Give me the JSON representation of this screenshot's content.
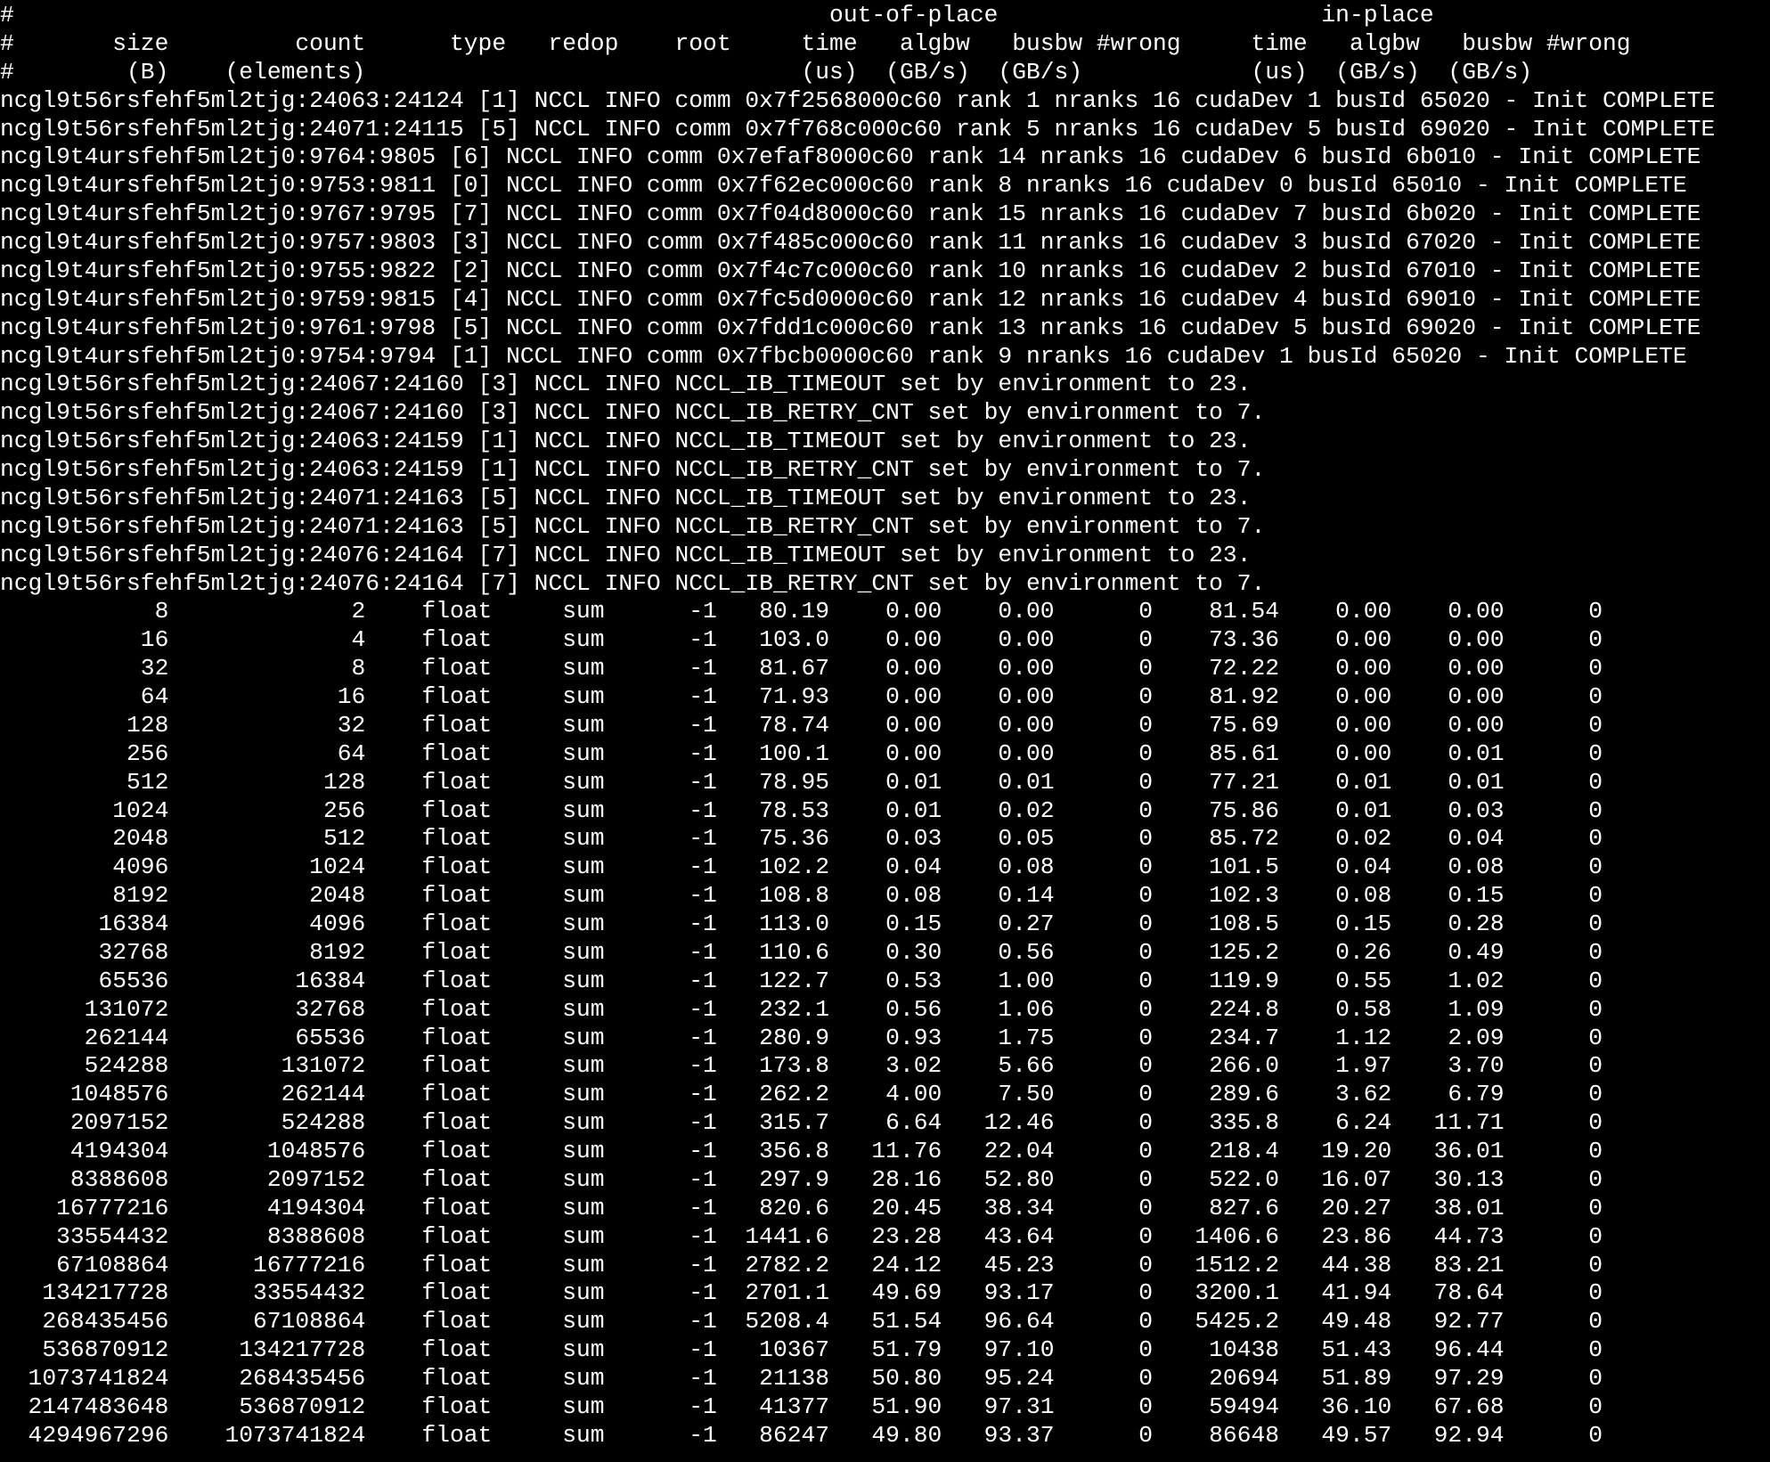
{
  "terminal": {
    "header_lines": [
      "#                                                          out-of-place                       in-place          ",
      "#       size         count      type   redop    root     time   algbw   busbw #wrong     time   algbw   busbw #wrong",
      "#        (B)    (elements)                               (us)  (GB/s)  (GB/s)            (us)  (GB/s)  (GB/s)       "
    ],
    "log_lines": [
      "ncgl9t56rsfehf5ml2tjg:24063:24124 [1] NCCL INFO comm 0x7f2568000c60 rank 1 nranks 16 cudaDev 1 busId 65020 - Init COMPLETE",
      "ncgl9t56rsfehf5ml2tjg:24071:24115 [5] NCCL INFO comm 0x7f768c000c60 rank 5 nranks 16 cudaDev 5 busId 69020 - Init COMPLETE",
      "ncgl9t4ursfehf5ml2tj0:9764:9805 [6] NCCL INFO comm 0x7efaf8000c60 rank 14 nranks 16 cudaDev 6 busId 6b010 - Init COMPLETE",
      "ncgl9t4ursfehf5ml2tj0:9753:9811 [0] NCCL INFO comm 0x7f62ec000c60 rank 8 nranks 16 cudaDev 0 busId 65010 - Init COMPLETE",
      "ncgl9t4ursfehf5ml2tj0:9767:9795 [7] NCCL INFO comm 0x7f04d8000c60 rank 15 nranks 16 cudaDev 7 busId 6b020 - Init COMPLETE",
      "ncgl9t4ursfehf5ml2tj0:9757:9803 [3] NCCL INFO comm 0x7f485c000c60 rank 11 nranks 16 cudaDev 3 busId 67020 - Init COMPLETE",
      "ncgl9t4ursfehf5ml2tj0:9755:9822 [2] NCCL INFO comm 0x7f4c7c000c60 rank 10 nranks 16 cudaDev 2 busId 67010 - Init COMPLETE",
      "ncgl9t4ursfehf5ml2tj0:9759:9815 [4] NCCL INFO comm 0x7fc5d0000c60 rank 12 nranks 16 cudaDev 4 busId 69010 - Init COMPLETE",
      "ncgl9t4ursfehf5ml2tj0:9761:9798 [5] NCCL INFO comm 0x7fdd1c000c60 rank 13 nranks 16 cudaDev 5 busId 69020 - Init COMPLETE",
      "ncgl9t4ursfehf5ml2tj0:9754:9794 [1] NCCL INFO comm 0x7fbcb0000c60 rank 9 nranks 16 cudaDev 1 busId 65020 - Init COMPLETE",
      "ncgl9t56rsfehf5ml2tjg:24067:24160 [3] NCCL INFO NCCL_IB_TIMEOUT set by environment to 23.",
      "ncgl9t56rsfehf5ml2tjg:24067:24160 [3] NCCL INFO NCCL_IB_RETRY_CNT set by environment to 7.",
      "ncgl9t56rsfehf5ml2tjg:24063:24159 [1] NCCL INFO NCCL_IB_TIMEOUT set by environment to 23.",
      "ncgl9t56rsfehf5ml2tjg:24063:24159 [1] NCCL INFO NCCL_IB_RETRY_CNT set by environment to 7.",
      "ncgl9t56rsfehf5ml2tjg:24071:24163 [5] NCCL INFO NCCL_IB_TIMEOUT set by environment to 23.",
      "ncgl9t56rsfehf5ml2tjg:24071:24163 [5] NCCL INFO NCCL_IB_RETRY_CNT set by environment to 7.",
      "ncgl9t56rsfehf5ml2tjg:24076:24164 [7] NCCL INFO NCCL_IB_TIMEOUT set by environment to 23.",
      "ncgl9t56rsfehf5ml2tjg:24076:24164 [7] NCCL INFO NCCL_IB_RETRY_CNT set by environment to 7."
    ],
    "rows": [
      [
        "8",
        "2",
        "float",
        "sum",
        "-1",
        "80.19",
        "0.00",
        "0.00",
        "0",
        "81.54",
        "0.00",
        "0.00",
        "0"
      ],
      [
        "16",
        "4",
        "float",
        "sum",
        "-1",
        "103.0",
        "0.00",
        "0.00",
        "0",
        "73.36",
        "0.00",
        "0.00",
        "0"
      ],
      [
        "32",
        "8",
        "float",
        "sum",
        "-1",
        "81.67",
        "0.00",
        "0.00",
        "0",
        "72.22",
        "0.00",
        "0.00",
        "0"
      ],
      [
        "64",
        "16",
        "float",
        "sum",
        "-1",
        "71.93",
        "0.00",
        "0.00",
        "0",
        "81.92",
        "0.00",
        "0.00",
        "0"
      ],
      [
        "128",
        "32",
        "float",
        "sum",
        "-1",
        "78.74",
        "0.00",
        "0.00",
        "0",
        "75.69",
        "0.00",
        "0.00",
        "0"
      ],
      [
        "256",
        "64",
        "float",
        "sum",
        "-1",
        "100.1",
        "0.00",
        "0.00",
        "0",
        "85.61",
        "0.00",
        "0.01",
        "0"
      ],
      [
        "512",
        "128",
        "float",
        "sum",
        "-1",
        "78.95",
        "0.01",
        "0.01",
        "0",
        "77.21",
        "0.01",
        "0.01",
        "0"
      ],
      [
        "1024",
        "256",
        "float",
        "sum",
        "-1",
        "78.53",
        "0.01",
        "0.02",
        "0",
        "75.86",
        "0.01",
        "0.03",
        "0"
      ],
      [
        "2048",
        "512",
        "float",
        "sum",
        "-1",
        "75.36",
        "0.03",
        "0.05",
        "0",
        "85.72",
        "0.02",
        "0.04",
        "0"
      ],
      [
        "4096",
        "1024",
        "float",
        "sum",
        "-1",
        "102.2",
        "0.04",
        "0.08",
        "0",
        "101.5",
        "0.04",
        "0.08",
        "0"
      ],
      [
        "8192",
        "2048",
        "float",
        "sum",
        "-1",
        "108.8",
        "0.08",
        "0.14",
        "0",
        "102.3",
        "0.08",
        "0.15",
        "0"
      ],
      [
        "16384",
        "4096",
        "float",
        "sum",
        "-1",
        "113.0",
        "0.15",
        "0.27",
        "0",
        "108.5",
        "0.15",
        "0.28",
        "0"
      ],
      [
        "32768",
        "8192",
        "float",
        "sum",
        "-1",
        "110.6",
        "0.30",
        "0.56",
        "0",
        "125.2",
        "0.26",
        "0.49",
        "0"
      ],
      [
        "65536",
        "16384",
        "float",
        "sum",
        "-1",
        "122.7",
        "0.53",
        "1.00",
        "0",
        "119.9",
        "0.55",
        "1.02",
        "0"
      ],
      [
        "131072",
        "32768",
        "float",
        "sum",
        "-1",
        "232.1",
        "0.56",
        "1.06",
        "0",
        "224.8",
        "0.58",
        "1.09",
        "0"
      ],
      [
        "262144",
        "65536",
        "float",
        "sum",
        "-1",
        "280.9",
        "0.93",
        "1.75",
        "0",
        "234.7",
        "1.12",
        "2.09",
        "0"
      ],
      [
        "524288",
        "131072",
        "float",
        "sum",
        "-1",
        "173.8",
        "3.02",
        "5.66",
        "0",
        "266.0",
        "1.97",
        "3.70",
        "0"
      ],
      [
        "1048576",
        "262144",
        "float",
        "sum",
        "-1",
        "262.2",
        "4.00",
        "7.50",
        "0",
        "289.6",
        "3.62",
        "6.79",
        "0"
      ],
      [
        "2097152",
        "524288",
        "float",
        "sum",
        "-1",
        "315.7",
        "6.64",
        "12.46",
        "0",
        "335.8",
        "6.24",
        "11.71",
        "0"
      ],
      [
        "4194304",
        "1048576",
        "float",
        "sum",
        "-1",
        "356.8",
        "11.76",
        "22.04",
        "0",
        "218.4",
        "19.20",
        "36.01",
        "0"
      ],
      [
        "8388608",
        "2097152",
        "float",
        "sum",
        "-1",
        "297.9",
        "28.16",
        "52.80",
        "0",
        "522.0",
        "16.07",
        "30.13",
        "0"
      ],
      [
        "16777216",
        "4194304",
        "float",
        "sum",
        "-1",
        "820.6",
        "20.45",
        "38.34",
        "0",
        "827.6",
        "20.27",
        "38.01",
        "0"
      ],
      [
        "33554432",
        "8388608",
        "float",
        "sum",
        "-1",
        "1441.6",
        "23.28",
        "43.64",
        "0",
        "1406.6",
        "23.86",
        "44.73",
        "0"
      ],
      [
        "67108864",
        "16777216",
        "float",
        "sum",
        "-1",
        "2782.2",
        "24.12",
        "45.23",
        "0",
        "1512.2",
        "44.38",
        "83.21",
        "0"
      ],
      [
        "134217728",
        "33554432",
        "float",
        "sum",
        "-1",
        "2701.1",
        "49.69",
        "93.17",
        "0",
        "3200.1",
        "41.94",
        "78.64",
        "0"
      ],
      [
        "268435456",
        "67108864",
        "float",
        "sum",
        "-1",
        "5208.4",
        "51.54",
        "96.64",
        "0",
        "5425.2",
        "49.48",
        "92.77",
        "0"
      ],
      [
        "536870912",
        "134217728",
        "float",
        "sum",
        "-1",
        "10367",
        "51.79",
        "97.10",
        "0",
        "10438",
        "51.43",
        "96.44",
        "0"
      ],
      [
        "1073741824",
        "268435456",
        "float",
        "sum",
        "-1",
        "21138",
        "50.80",
        "95.24",
        "0",
        "20694",
        "51.89",
        "97.29",
        "0"
      ],
      [
        "2147483648",
        "536870912",
        "float",
        "sum",
        "-1",
        "41377",
        "51.90",
        "97.31",
        "0",
        "59494",
        "36.10",
        "67.68",
        "0"
      ],
      [
        "4294967296",
        "1073741824",
        "float",
        "sum",
        "-1",
        "86247",
        "49.80",
        "93.37",
        "0",
        "86648",
        "49.57",
        "92.94",
        "0"
      ]
    ]
  },
  "colors": {
    "background": "#000000",
    "foreground": "#ffffff"
  }
}
